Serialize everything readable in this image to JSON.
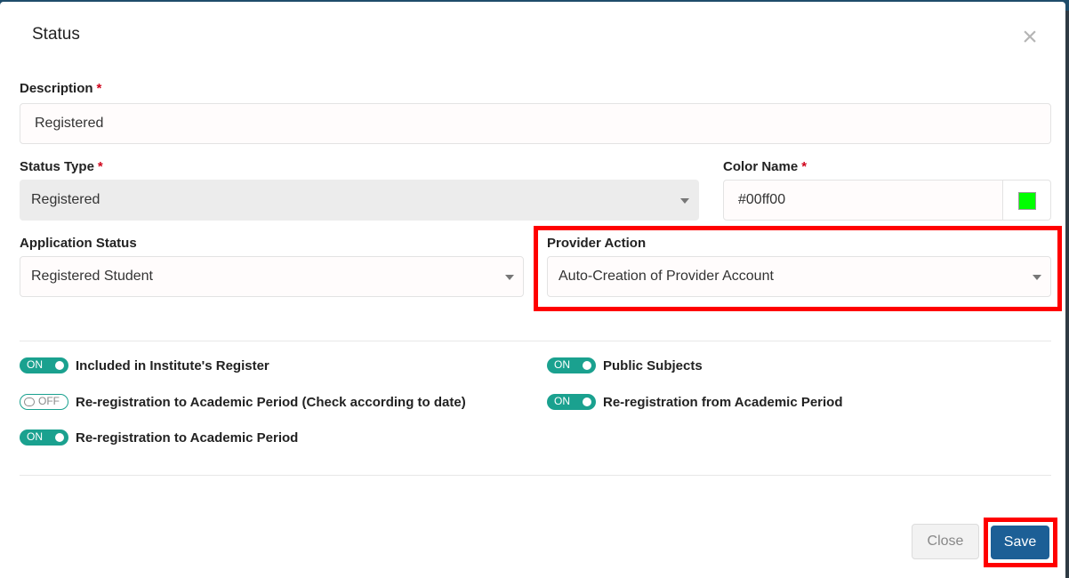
{
  "modal": {
    "title": "Status",
    "close_icon": "close-x-icon"
  },
  "form": {
    "description": {
      "label": "Description",
      "required_mark": "*",
      "value": "Registered"
    },
    "status_type": {
      "label": "Status Type",
      "required_mark": "*",
      "value": "Registered"
    },
    "color_name": {
      "label": "Color Name",
      "required_mark": "*",
      "value": "#00ff00",
      "swatch_color": "#00ff00"
    },
    "application_status": {
      "label": "Application Status",
      "value": "Registered Student"
    },
    "provider_action": {
      "label": "Provider Action",
      "value": "Auto-Creation of Provider Account"
    }
  },
  "toggles": [
    {
      "label": "Included in Institute's Register",
      "state": "ON"
    },
    {
      "label": "Public Subjects",
      "state": "ON"
    },
    {
      "label": "Re-registration to Academic Period (Check according to date)",
      "state": "OFF"
    },
    {
      "label": "Re-registration from Academic Period",
      "state": "ON"
    },
    {
      "label": "Re-registration to Academic Period",
      "state": "ON"
    }
  ],
  "footer": {
    "close_label": "Close",
    "save_label": "Save"
  },
  "colors": {
    "accent_toggle": "#1aa18f",
    "save_button": "#1c5f96",
    "highlight": "#ff0000",
    "required": "#d0021b"
  }
}
